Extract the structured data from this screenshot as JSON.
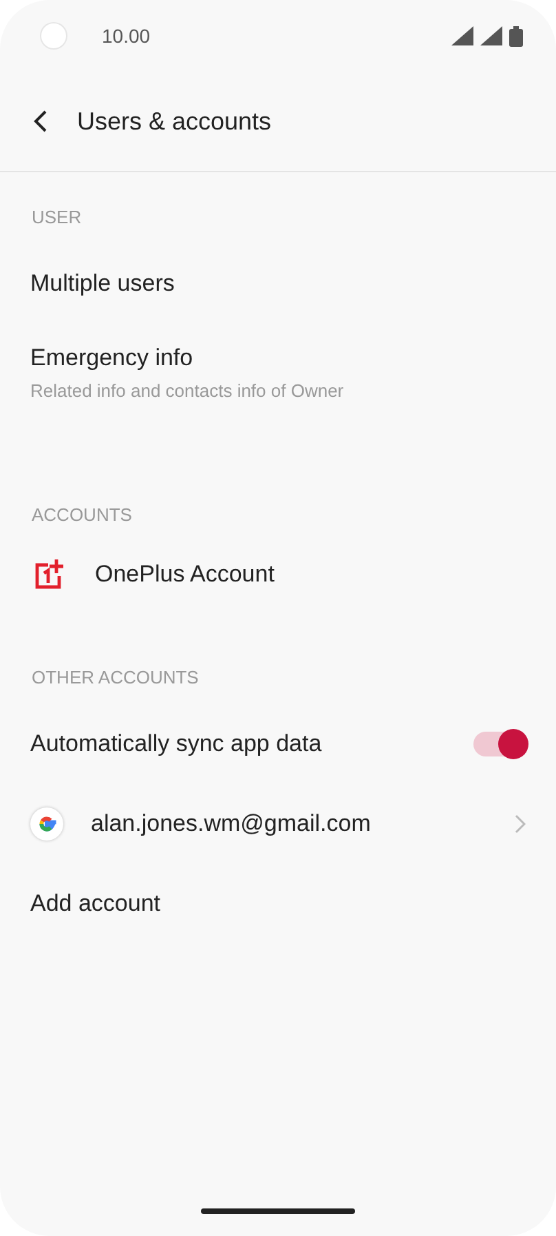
{
  "status_bar": {
    "time": "10.00"
  },
  "header": {
    "title": "Users & accounts"
  },
  "sections": [
    {
      "title": "USER",
      "items": [
        {
          "kind": "plain",
          "title": "Multiple users"
        },
        {
          "kind": "plain",
          "title": "Emergency info",
          "subtitle": "Related info and contacts info of Owner"
        }
      ]
    },
    {
      "title": "ACCOUNTS",
      "items": [
        {
          "kind": "oneplus",
          "title": "OnePlus Account"
        }
      ]
    },
    {
      "title": "OTHER ACCOUNTS",
      "items": [
        {
          "kind": "toggle",
          "title": "Automatically sync app data",
          "on": true
        },
        {
          "kind": "google",
          "title": "alan.jones.wm@gmail.com"
        },
        {
          "kind": "plain",
          "title": "Add account"
        }
      ]
    }
  ]
}
